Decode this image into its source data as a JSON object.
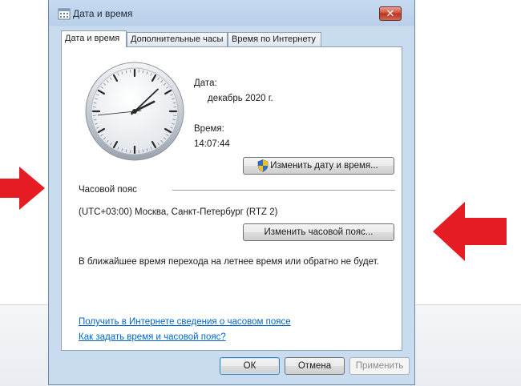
{
  "window": {
    "title": "Дата и время",
    "close_label": "✕"
  },
  "tabs": [
    {
      "label": "Дата и время",
      "active": true
    },
    {
      "label": "Дополнительные часы",
      "active": false
    },
    {
      "label": "Время по Интернету",
      "active": false
    }
  ],
  "datetime": {
    "date_label": "Дата:",
    "date_value": "декабрь 2020 г.",
    "time_label": "Время:",
    "time_value": "14:07:44",
    "change_button": "Изменить дату и время..."
  },
  "timezone": {
    "heading": "Часовой пояс",
    "value": "(UTC+03:00) Москва, Санкт-Петербург (RTZ 2)",
    "change_button": "Изменить часовой пояс...",
    "dst_note": "В ближайшее время перехода на летнее время или обратно не будет."
  },
  "links": {
    "timezone_info": "Получить в Интернете сведения о часовом поясе",
    "how_to": "Как задать время и часовой пояс?"
  },
  "footer": {
    "ok": "ОК",
    "cancel": "Отмена",
    "apply": "Применить"
  },
  "colors": {
    "arrow": "#e51c23",
    "link": "#0066cc",
    "close_button": "#c9452f"
  },
  "icons": {
    "title": "date-time-icon",
    "shield": "uac-shield-icon"
  }
}
